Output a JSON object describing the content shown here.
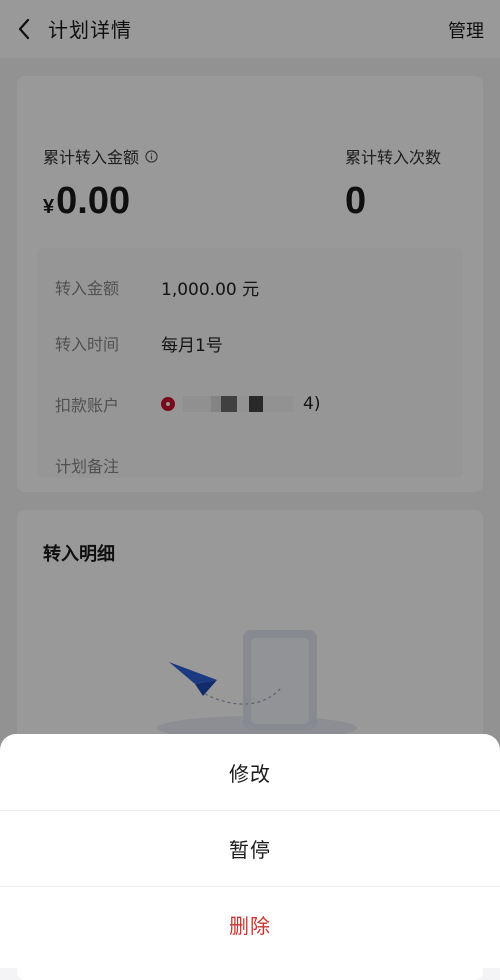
{
  "header": {
    "title": "计划详情",
    "manage_label": "管理"
  },
  "summary": {
    "total_amount_label": "累计转入金额",
    "currency_symbol": "¥",
    "total_amount_value": "0.00",
    "total_count_label": "累计转入次数",
    "total_count_value": "0"
  },
  "plan": {
    "amount_label": "转入金额",
    "amount_value": "1,000.00 元",
    "time_label": "转入时间",
    "time_value": "每月1号",
    "account_label": "扣款账户",
    "account_suffix": "4)",
    "note_label": "计划备注",
    "note_value": ""
  },
  "details": {
    "title": "转入明细"
  },
  "action_sheet": {
    "items": [
      {
        "label": "修改"
      },
      {
        "label": "暂停"
      },
      {
        "label": "删除"
      }
    ],
    "danger_color": "#c8342e"
  }
}
